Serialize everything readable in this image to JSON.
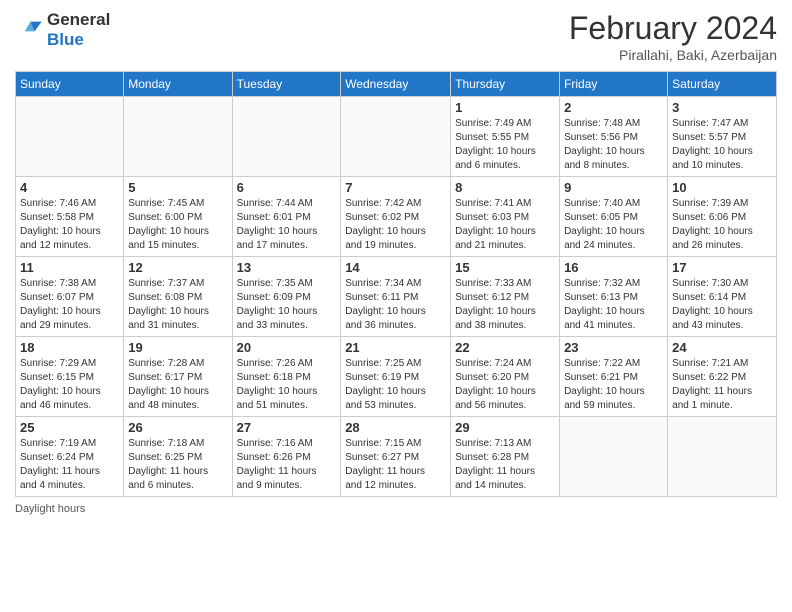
{
  "logo": {
    "line1": "General",
    "line2": "Blue"
  },
  "title": "February 2024",
  "location": "Pirallahi, Baki, Azerbaijan",
  "footer": "Daylight hours",
  "headers": [
    "Sunday",
    "Monday",
    "Tuesday",
    "Wednesday",
    "Thursday",
    "Friday",
    "Saturday"
  ],
  "weeks": [
    [
      {
        "day": "",
        "info": ""
      },
      {
        "day": "",
        "info": ""
      },
      {
        "day": "",
        "info": ""
      },
      {
        "day": "",
        "info": ""
      },
      {
        "day": "1",
        "info": "Sunrise: 7:49 AM\nSunset: 5:55 PM\nDaylight: 10 hours\nand 6 minutes."
      },
      {
        "day": "2",
        "info": "Sunrise: 7:48 AM\nSunset: 5:56 PM\nDaylight: 10 hours\nand 8 minutes."
      },
      {
        "day": "3",
        "info": "Sunrise: 7:47 AM\nSunset: 5:57 PM\nDaylight: 10 hours\nand 10 minutes."
      }
    ],
    [
      {
        "day": "4",
        "info": "Sunrise: 7:46 AM\nSunset: 5:58 PM\nDaylight: 10 hours\nand 12 minutes."
      },
      {
        "day": "5",
        "info": "Sunrise: 7:45 AM\nSunset: 6:00 PM\nDaylight: 10 hours\nand 15 minutes."
      },
      {
        "day": "6",
        "info": "Sunrise: 7:44 AM\nSunset: 6:01 PM\nDaylight: 10 hours\nand 17 minutes."
      },
      {
        "day": "7",
        "info": "Sunrise: 7:42 AM\nSunset: 6:02 PM\nDaylight: 10 hours\nand 19 minutes."
      },
      {
        "day": "8",
        "info": "Sunrise: 7:41 AM\nSunset: 6:03 PM\nDaylight: 10 hours\nand 21 minutes."
      },
      {
        "day": "9",
        "info": "Sunrise: 7:40 AM\nSunset: 6:05 PM\nDaylight: 10 hours\nand 24 minutes."
      },
      {
        "day": "10",
        "info": "Sunrise: 7:39 AM\nSunset: 6:06 PM\nDaylight: 10 hours\nand 26 minutes."
      }
    ],
    [
      {
        "day": "11",
        "info": "Sunrise: 7:38 AM\nSunset: 6:07 PM\nDaylight: 10 hours\nand 29 minutes."
      },
      {
        "day": "12",
        "info": "Sunrise: 7:37 AM\nSunset: 6:08 PM\nDaylight: 10 hours\nand 31 minutes."
      },
      {
        "day": "13",
        "info": "Sunrise: 7:35 AM\nSunset: 6:09 PM\nDaylight: 10 hours\nand 33 minutes."
      },
      {
        "day": "14",
        "info": "Sunrise: 7:34 AM\nSunset: 6:11 PM\nDaylight: 10 hours\nand 36 minutes."
      },
      {
        "day": "15",
        "info": "Sunrise: 7:33 AM\nSunset: 6:12 PM\nDaylight: 10 hours\nand 38 minutes."
      },
      {
        "day": "16",
        "info": "Sunrise: 7:32 AM\nSunset: 6:13 PM\nDaylight: 10 hours\nand 41 minutes."
      },
      {
        "day": "17",
        "info": "Sunrise: 7:30 AM\nSunset: 6:14 PM\nDaylight: 10 hours\nand 43 minutes."
      }
    ],
    [
      {
        "day": "18",
        "info": "Sunrise: 7:29 AM\nSunset: 6:15 PM\nDaylight: 10 hours\nand 46 minutes."
      },
      {
        "day": "19",
        "info": "Sunrise: 7:28 AM\nSunset: 6:17 PM\nDaylight: 10 hours\nand 48 minutes."
      },
      {
        "day": "20",
        "info": "Sunrise: 7:26 AM\nSunset: 6:18 PM\nDaylight: 10 hours\nand 51 minutes."
      },
      {
        "day": "21",
        "info": "Sunrise: 7:25 AM\nSunset: 6:19 PM\nDaylight: 10 hours\nand 53 minutes."
      },
      {
        "day": "22",
        "info": "Sunrise: 7:24 AM\nSunset: 6:20 PM\nDaylight: 10 hours\nand 56 minutes."
      },
      {
        "day": "23",
        "info": "Sunrise: 7:22 AM\nSunset: 6:21 PM\nDaylight: 10 hours\nand 59 minutes."
      },
      {
        "day": "24",
        "info": "Sunrise: 7:21 AM\nSunset: 6:22 PM\nDaylight: 11 hours\nand 1 minute."
      }
    ],
    [
      {
        "day": "25",
        "info": "Sunrise: 7:19 AM\nSunset: 6:24 PM\nDaylight: 11 hours\nand 4 minutes."
      },
      {
        "day": "26",
        "info": "Sunrise: 7:18 AM\nSunset: 6:25 PM\nDaylight: 11 hours\nand 6 minutes."
      },
      {
        "day": "27",
        "info": "Sunrise: 7:16 AM\nSunset: 6:26 PM\nDaylight: 11 hours\nand 9 minutes."
      },
      {
        "day": "28",
        "info": "Sunrise: 7:15 AM\nSunset: 6:27 PM\nDaylight: 11 hours\nand 12 minutes."
      },
      {
        "day": "29",
        "info": "Sunrise: 7:13 AM\nSunset: 6:28 PM\nDaylight: 11 hours\nand 14 minutes."
      },
      {
        "day": "",
        "info": ""
      },
      {
        "day": "",
        "info": ""
      }
    ]
  ]
}
